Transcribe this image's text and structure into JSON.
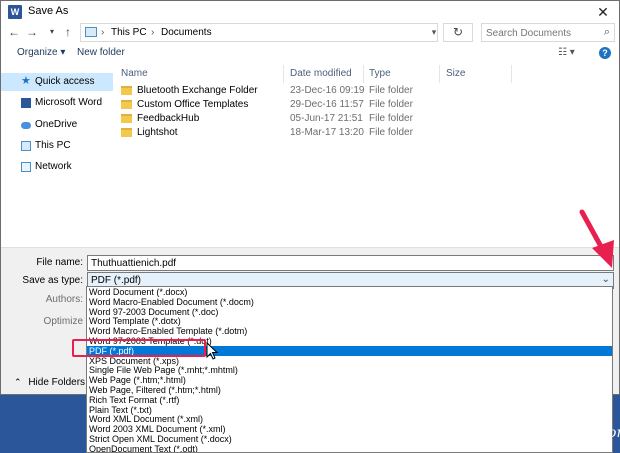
{
  "window": {
    "title": "Save As",
    "app_icon": "W"
  },
  "address": {
    "breadcrumbs": [
      "This PC",
      "Documents"
    ],
    "search_placeholder": "Search Documents"
  },
  "toolbar": {
    "organize": "Organize ▾",
    "new_folder": "New folder",
    "view": "☷ ▾",
    "help": "?"
  },
  "sidebar": {
    "items": [
      {
        "label": "Quick access",
        "icon": "star-icon"
      },
      {
        "label": "Microsoft Word",
        "icon": "word-icon"
      },
      {
        "label": "OneDrive",
        "icon": "cloud-icon"
      },
      {
        "label": "This PC",
        "icon": "computer-icon"
      },
      {
        "label": "Network",
        "icon": "network-icon"
      }
    ]
  },
  "filelist": {
    "columns": [
      "Name",
      "Date modified",
      "Type",
      "Size"
    ],
    "rows": [
      {
        "name": "Bluetooth Exchange Folder",
        "date": "23-Dec-16 09:19",
        "type": "File folder"
      },
      {
        "name": "Custom Office Templates",
        "date": "29-Dec-16 11:57",
        "type": "File folder"
      },
      {
        "name": "FeedbackHub",
        "date": "05-Jun-17 21:51",
        "type": "File folder"
      },
      {
        "name": "Lightshot",
        "date": "18-Mar-17 13:20",
        "type": "File folder"
      }
    ]
  },
  "form": {
    "filename_label": "File name:",
    "filename_value": "Thuthuattienich.pdf",
    "type_label": "Save as type:",
    "type_value": "PDF (*.pdf)",
    "authors_label": "Authors:",
    "optimize_label": "Optimize",
    "hide_folders": "Hide Folders"
  },
  "type_options": [
    "Word Document (*.docx)",
    "Word Macro-Enabled Document (*.docm)",
    "Word 97-2003 Document (*.doc)",
    "Word Template (*.dotx)",
    "Word Macro-Enabled Template (*.dotm)",
    "Word 97-2003 Template (*.dot)",
    "PDF (*.pdf)",
    "XPS Document (*.xps)",
    "Single File Web Page (*.mht;*.mhtml)",
    "Web Page (*.htm;*.html)",
    "Web Page, Filtered (*.htm;*.html)",
    "Rich Text Format (*.rtf)",
    "Plain Text (*.txt)",
    "Word XML Document (*.xml)",
    "Word 2003 XML Document (*.xml)",
    "Strict Open XML Document (*.docx)",
    "OpenDocument Text (*.odt)"
  ],
  "selected_type_index": 6,
  "watermark": "Thuthuattienich.com",
  "colors": {
    "selection": "#0078d7",
    "annotation": "#e8204f",
    "word_blue": "#2b579a"
  }
}
